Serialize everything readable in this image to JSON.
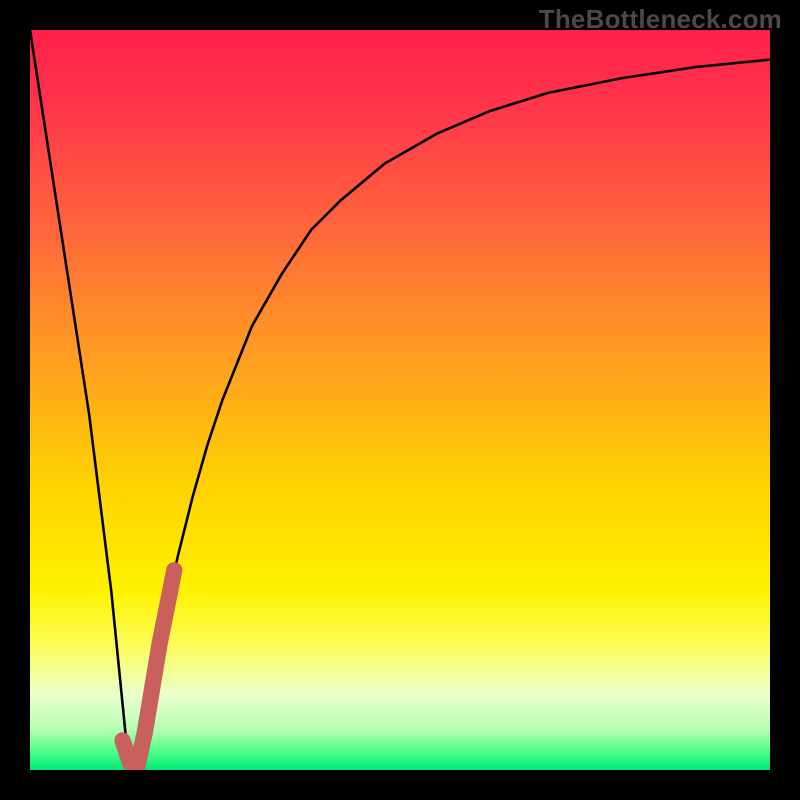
{
  "watermark": "TheBottleneck.com",
  "colors": {
    "frame": "#000000",
    "curve": "#000000",
    "highlight": "#c9605e",
    "gradient_stops": [
      {
        "offset": 0.0,
        "color": "#ff1f4b"
      },
      {
        "offset": 0.12,
        "color": "#ff3a4a"
      },
      {
        "offset": 0.28,
        "color": "#ff6a3a"
      },
      {
        "offset": 0.45,
        "color": "#ffa01f"
      },
      {
        "offset": 0.62,
        "color": "#ffd400"
      },
      {
        "offset": 0.76,
        "color": "#fff200"
      },
      {
        "offset": 0.84,
        "color": "#fbff66"
      },
      {
        "offset": 0.9,
        "color": "#eaffcf"
      },
      {
        "offset": 0.945,
        "color": "#b6ffb0"
      },
      {
        "offset": 0.975,
        "color": "#4dff87"
      },
      {
        "offset": 1.0,
        "color": "#00e874"
      }
    ]
  },
  "chart_data": {
    "type": "line",
    "title": "",
    "xlabel": "",
    "ylabel": "",
    "xlim": [
      0,
      100
    ],
    "ylim": [
      0,
      100
    ],
    "series": [
      {
        "name": "bottleneck-curve",
        "x": [
          0,
          2,
          4,
          6,
          8,
          10,
          11,
          12,
          13,
          14,
          15,
          16,
          18,
          20,
          22,
          24,
          26,
          28,
          30,
          34,
          38,
          42,
          48,
          55,
          62,
          70,
          80,
          90,
          100
        ],
        "y": [
          100,
          87,
          74,
          61,
          48,
          32,
          24,
          14,
          4,
          0,
          4,
          10,
          20,
          29,
          37,
          44,
          50,
          55,
          60,
          67,
          73,
          77,
          82,
          86,
          89,
          91.5,
          93.5,
          95,
          96
        ]
      },
      {
        "name": "highlight-segment",
        "x": [
          12.5,
          13.5,
          14.5,
          15.5,
          16.5,
          17.5,
          18.5,
          19.5
        ],
        "y": [
          4.0,
          1.0,
          0.5,
          5.0,
          11.0,
          17.0,
          22.0,
          27.0
        ]
      }
    ]
  }
}
